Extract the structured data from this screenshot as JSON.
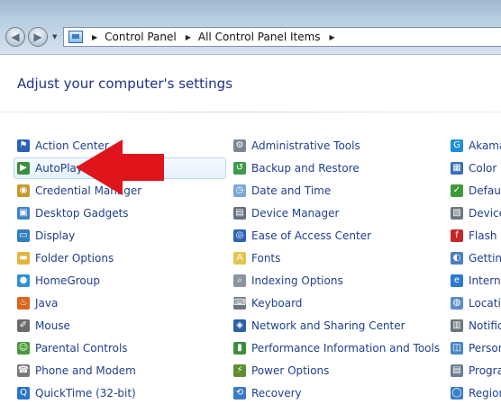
{
  "breadcrumb": [
    "Control Panel",
    "All Control Panel Items"
  ],
  "page_title": "Adjust your computer's settings",
  "columns": [
    {
      "items": [
        {
          "label": "Action Center",
          "icon": "flag-icon",
          "color": "#2c61b8",
          "glyph": "⚑"
        },
        {
          "label": "AutoPlay",
          "icon": "autoplay-icon",
          "color": "#3b8f3c",
          "glyph": "▶"
        },
        {
          "label": "Credential Manager",
          "icon": "credential-icon",
          "color": "#c59a2a",
          "glyph": "◉"
        },
        {
          "label": "Desktop Gadgets",
          "icon": "gadgets-icon",
          "color": "#3e84c8",
          "glyph": "▣"
        },
        {
          "label": "Display",
          "icon": "display-icon",
          "color": "#2f7fbf",
          "glyph": "▭"
        },
        {
          "label": "Folder Options",
          "icon": "folder-icon",
          "color": "#e2b53c",
          "glyph": "▬"
        },
        {
          "label": "HomeGroup",
          "icon": "homegroup-icon",
          "color": "#2f8fd8",
          "glyph": "●"
        },
        {
          "label": "Java",
          "icon": "java-icon",
          "color": "#d9661f",
          "glyph": "♨"
        },
        {
          "label": "Mouse",
          "icon": "mouse-icon",
          "color": "#6b6b6b",
          "glyph": "✐"
        },
        {
          "label": "Parental Controls",
          "icon": "parental-icon",
          "color": "#4a9a3b",
          "glyph": "☺"
        },
        {
          "label": "Phone and Modem",
          "icon": "phone-icon",
          "color": "#7a7a7a",
          "glyph": "☎"
        },
        {
          "label": "QuickTime (32-bit)",
          "icon": "quicktime-icon",
          "color": "#2a74c9",
          "glyph": "Q"
        }
      ]
    },
    {
      "items": [
        {
          "label": "Administrative Tools",
          "icon": "admin-tools-icon",
          "color": "#7d8794",
          "glyph": "⚙"
        },
        {
          "label": "Backup and Restore",
          "icon": "backup-icon",
          "color": "#3c9b4a",
          "glyph": "↺"
        },
        {
          "label": "Date and Time",
          "icon": "clock-icon",
          "color": "#7aa6d8",
          "glyph": "◷"
        },
        {
          "label": "Device Manager",
          "icon": "device-manager-icon",
          "color": "#66717d",
          "glyph": "▤"
        },
        {
          "label": "Ease of Access Center",
          "icon": "ease-access-icon",
          "color": "#2c63b5",
          "glyph": "◎"
        },
        {
          "label": "Fonts",
          "icon": "fonts-icon",
          "color": "#e5c44f",
          "glyph": "A"
        },
        {
          "label": "Indexing Options",
          "icon": "indexing-icon",
          "color": "#8a94a0",
          "glyph": "⌕"
        },
        {
          "label": "Keyboard",
          "icon": "keyboard-icon",
          "color": "#6d7680",
          "glyph": "⌨"
        },
        {
          "label": "Network and Sharing Center",
          "icon": "network-icon",
          "color": "#2c5fa8",
          "glyph": "◈"
        },
        {
          "label": "Performance Information and Tools",
          "icon": "performance-icon",
          "color": "#3e8d3e",
          "glyph": "▮"
        },
        {
          "label": "Power Options",
          "icon": "power-icon",
          "color": "#5d8f2f",
          "glyph": "⚡"
        },
        {
          "label": "Recovery",
          "icon": "recovery-icon",
          "color": "#3a7bc4",
          "glyph": "⟲"
        }
      ]
    },
    {
      "items": [
        {
          "label": "Akama",
          "icon": "akamai-icon",
          "color": "#1d8fd6",
          "glyph": "G"
        },
        {
          "label": "Color M",
          "icon": "color-management-icon",
          "color": "#3a6fb8",
          "glyph": "▦"
        },
        {
          "label": "Default",
          "icon": "default-programs-icon",
          "color": "#3f9b3a",
          "glyph": "✓"
        },
        {
          "label": "Devices",
          "icon": "devices-icon",
          "color": "#6c7681",
          "glyph": "▧"
        },
        {
          "label": "Flash P",
          "icon": "flash-icon",
          "color": "#c62828",
          "glyph": "f"
        },
        {
          "label": "Getting",
          "icon": "getting-started-icon",
          "color": "#4b7fc0",
          "glyph": "◐"
        },
        {
          "label": "Interne",
          "icon": "internet-options-icon",
          "color": "#2a7bd0",
          "glyph": "e"
        },
        {
          "label": "Locatio",
          "icon": "location-icon",
          "color": "#5a8fc8",
          "glyph": "◍"
        },
        {
          "label": "Notific",
          "icon": "notification-icon",
          "color": "#6b7480",
          "glyph": "▥"
        },
        {
          "label": "Person",
          "icon": "personalization-icon",
          "color": "#4a86c6",
          "glyph": "◫"
        },
        {
          "label": "Progra",
          "icon": "programs-icon",
          "color": "#6c7f94",
          "glyph": "▤"
        },
        {
          "label": "Region",
          "icon": "region-icon",
          "color": "#3c7ec9",
          "glyph": "◯"
        }
      ]
    }
  ],
  "highlighted_item": "AutoPlay",
  "annotation_arrow_color": "#e0141b"
}
